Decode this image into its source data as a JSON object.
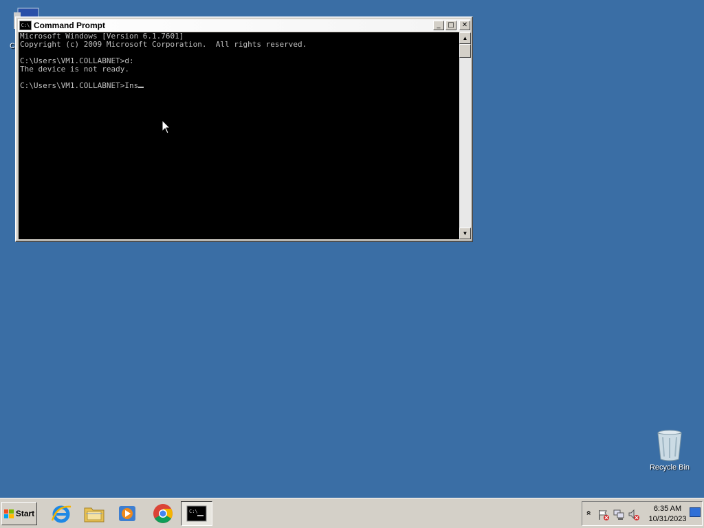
{
  "desktop": {
    "background_color": "#3a6ea5",
    "partial_icon_label": "C",
    "recycle_bin_label": "Recycle Bin"
  },
  "window": {
    "title": "Command Prompt",
    "minimize_glyph": "_",
    "maximize_glyph": "□",
    "close_glyph": "✕",
    "console_lines": [
      "Microsoft Windows [Version 6.1.7601]",
      "Copyright (c) 2009 Microsoft Corporation.  All rights reserved.",
      "",
      "C:\\Users\\VM1.COLLABNET>d:",
      "The device is not ready.",
      "",
      "C:\\Users\\VM1.COLLABNET>Ins"
    ],
    "scroll_up_glyph": "▲",
    "scroll_down_glyph": "▼"
  },
  "taskbar": {
    "start_label": "Start",
    "apps": [
      {
        "name": "internet-explorer",
        "icon": "ie-icon"
      },
      {
        "name": "windows-explorer",
        "icon": "folder-icon"
      },
      {
        "name": "media-player",
        "icon": "media-player-icon"
      },
      {
        "name": "chrome",
        "icon": "chrome-icon"
      },
      {
        "name": "command-prompt",
        "icon": "cmd-icon",
        "active": true
      }
    ],
    "tray": {
      "expand_glyph": "»",
      "time": "6:35 AM",
      "date": "10/31/2023"
    }
  }
}
